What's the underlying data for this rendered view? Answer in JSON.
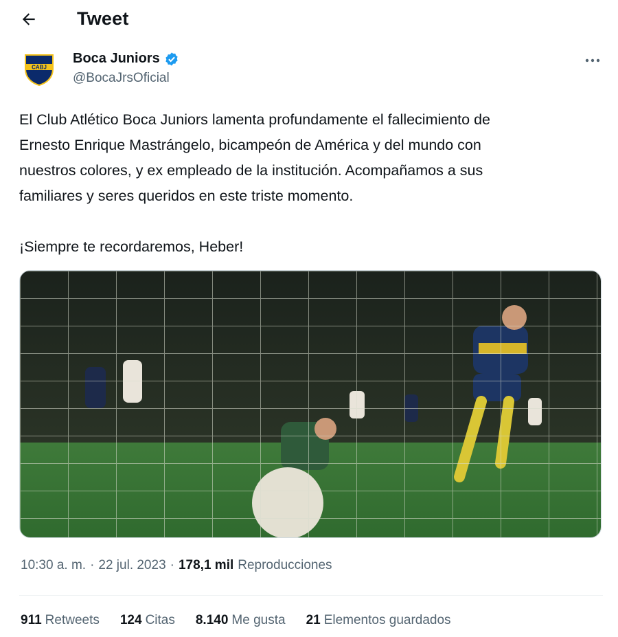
{
  "header": {
    "title": "Tweet",
    "back_icon": "arrow-left-icon"
  },
  "author": {
    "display_name": "Boca Juniors",
    "handle": "@BocaJrsOficial",
    "avatar_text": "CABJ",
    "verified": true,
    "colors": {
      "crest_blue": "#0b2a6b",
      "crest_gold": "#f4c21a",
      "verified_blue": "#1d9bf0"
    }
  },
  "tweet": {
    "lines": [
      "El Club Atlético Boca Juniors lamenta profundamente el fallecimiento de",
      "Ernesto Enrique Mastrángelo, bicampeón de América y del mundo con",
      "nuestros colores, y ex empleado de la institución. Acompañamos a sus",
      "familiares y seres queridos en este triste momento."
    ],
    "closing": "¡Siempre te recordaremos, Heber!"
  },
  "meta": {
    "time": "10:30 a. m.",
    "separator": "·",
    "date": "22 jul. 2023",
    "views_count": "178,1 mil",
    "views_label": "Reproducciones"
  },
  "stats": [
    {
      "count": "911",
      "label": "Retweets"
    },
    {
      "count": "124",
      "label": "Citas"
    },
    {
      "count": "8.140",
      "label": "Me gusta"
    },
    {
      "count": "21",
      "label": "Elementos guardados"
    }
  ]
}
